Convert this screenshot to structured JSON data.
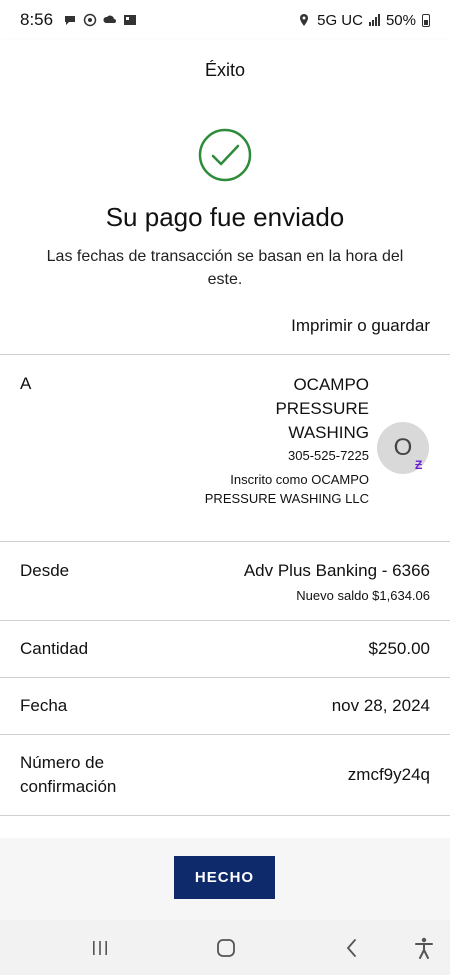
{
  "status_bar": {
    "time": "8:56",
    "network": "5G UC",
    "battery": "50%"
  },
  "header": {
    "title": "Éxito"
  },
  "success": {
    "title": "Su pago fue enviado",
    "subtitle": "Las fechas de transacción se basan en la hora del este.",
    "print_label": "Imprimir o guardar",
    "icon_color": "#2e8b3a"
  },
  "recipient": {
    "label": "A",
    "name": "OCAMPO PRESSURE WASHING",
    "phone": "305-525-7225",
    "registered": "Inscrito como OCAMPO PRESSURE WASHING LLC",
    "avatar_letter": "O"
  },
  "from": {
    "label": "Desde",
    "account": "Adv Plus Banking - 6366",
    "balance": "Nuevo saldo $1,634.06"
  },
  "amount": {
    "label": "Cantidad",
    "value": "$250.00"
  },
  "date": {
    "label": "Fecha",
    "value": "nov 28, 2024"
  },
  "confirmation": {
    "label": "Número de confirmación",
    "value": "zmcf9y24q"
  },
  "done_button": {
    "label": "HECHO",
    "color": "#0f2a6b"
  },
  "zelle_color": "#6d1ed4"
}
